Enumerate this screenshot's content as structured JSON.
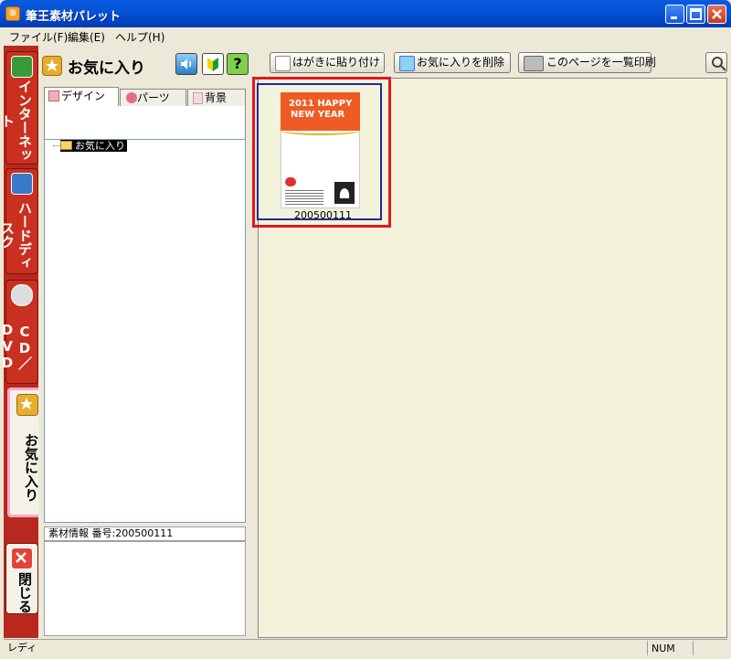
{
  "window": {
    "title": "筆王素材パレット"
  },
  "menu": [
    {
      "label": "ファイル(F)"
    },
    {
      "label": "編集(E)"
    },
    {
      "label": "ヘルプ(H)"
    }
  ],
  "vertical_tabs": {
    "internet": "インターネット",
    "hard_disk": "ハードディスク",
    "cd_dvd": "CD／DVD",
    "favorites": "お気に入り",
    "close": "閉じる"
  },
  "left_panel": {
    "title": "お気に入り",
    "help_glyph": "?",
    "subtabs": [
      {
        "label": "デザイン"
      },
      {
        "label": "パーツ"
      },
      {
        "label": "背景"
      }
    ],
    "tree_node": "お気に入り",
    "info_label": "素材情報 番号:200500111"
  },
  "toolbar": {
    "paste_label": "はがきに貼り付け",
    "remove_label": "お気に入りを削除",
    "print_label": "このページを一覧印刷"
  },
  "thumbnail": {
    "card_line1": "2011 HAPPY",
    "card_line2": "NEW YEAR",
    "label": "200500111"
  },
  "status": {
    "text": "レディ",
    "num": "NUM"
  },
  "icons": {
    "app": "app-icon",
    "star": "star-icon",
    "speaker": "speaker-icon",
    "beginner": "beginner-mark-icon",
    "help": "help-icon",
    "search": "search-icon"
  },
  "colors": {
    "title_bar": "#0453d6",
    "strip_red": "#b8281e",
    "content_bg": "#f3f3dc",
    "highlight_red": "#e0181e",
    "selection_blue": "#1f2aa0",
    "card_orange": "#f05a24"
  }
}
